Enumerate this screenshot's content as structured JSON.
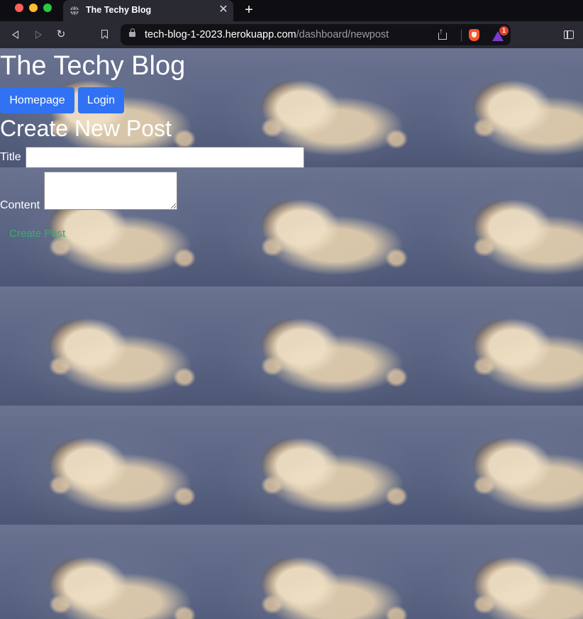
{
  "browser": {
    "tab_title": "The Techy Blog",
    "url_host": "tech-blog-1-2023.herokuapp.com",
    "url_path": "/dashboard/newpost",
    "rewards_badge_count": "1",
    "icons": {
      "tab": "globe-icon",
      "close": "close-icon",
      "new_tab": "plus-icon",
      "back": "back-icon",
      "forward": "forward-icon",
      "reload": "reload-icon",
      "bookmark": "bookmark-icon",
      "secure": "lock-icon",
      "share": "share-icon",
      "shields": "brave-shields-icon",
      "rewards": "brave-rewards-icon",
      "sidebar": "sidebar-toggle-icon"
    }
  },
  "page": {
    "site_title": "The Techy Blog",
    "nav": {
      "homepage_label": "Homepage",
      "login_label": "Login"
    },
    "heading": "Create New Post",
    "form": {
      "title_label": "Title",
      "title_value": "",
      "content_label": "Content",
      "content_value": "",
      "submit_label": "Create Post"
    }
  },
  "colors": {
    "nav_button_bg": "#3072f3",
    "submit_text": "#32b06a",
    "page_text": "#ffffff",
    "chrome_bg": "#2a2a33"
  }
}
